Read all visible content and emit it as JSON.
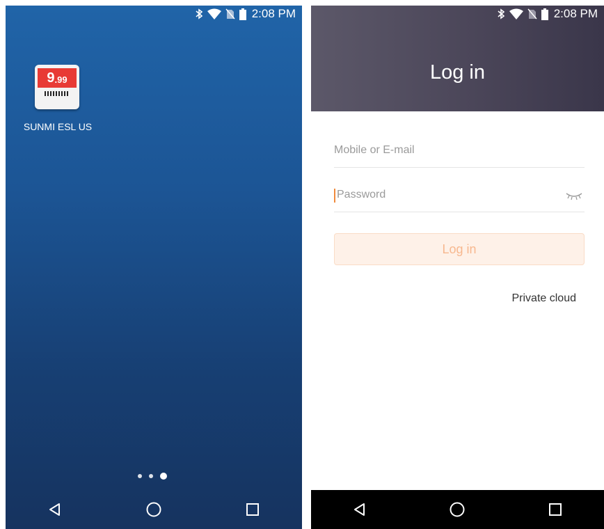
{
  "status_bar": {
    "time": "2:08 PM",
    "icons": [
      "bluetooth-icon",
      "wifi-icon",
      "no-sim-icon",
      "battery-icon"
    ]
  },
  "home_screen": {
    "app": {
      "name": "SUNMI ESL US",
      "icon_price_main": "9",
      "icon_price_cents": ".99"
    },
    "page_indicator": {
      "pages": 3,
      "current": 3
    }
  },
  "login_screen": {
    "title": "Log in",
    "mobile_placeholder": "Mobile or E-mail",
    "password_placeholder": "Password",
    "login_button": "Log in",
    "private_cloud": "Private cloud",
    "colors": {
      "header": "#4b4659",
      "accent": "#f08a3c",
      "button_bg": "#fef1e8",
      "button_text": "#f7b88f"
    }
  },
  "nav_bar": {
    "buttons": [
      "back-icon",
      "home-icon",
      "recents-icon"
    ]
  }
}
